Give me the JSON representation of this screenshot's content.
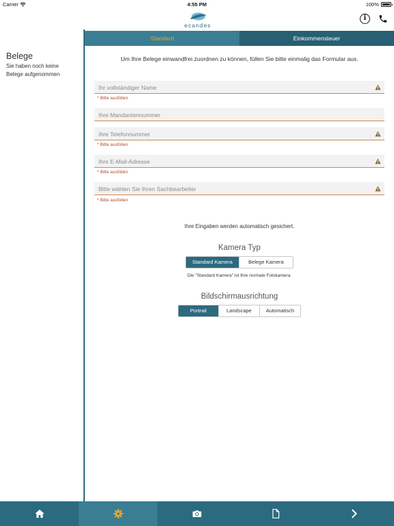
{
  "status_bar": {
    "carrier": "Carrier",
    "time": "4:55 PM",
    "battery": "100%"
  },
  "header": {
    "logo_text": "ecandes",
    "info_icon": "info-icon",
    "phone_icon": "phone-icon"
  },
  "sidebar": {
    "title": "Belege",
    "subtitle": "Sie haben noch keine Belege aufgenommen"
  },
  "tabs": [
    {
      "label": "Standard",
      "active": true
    },
    {
      "label": "Einkommensteuer",
      "active": false
    }
  ],
  "form": {
    "intro": "Um Ihre Belege einwandfrei zuordnen zu können, füllen Sie bitte einmalig das Formular aus.",
    "fields": [
      {
        "placeholder": "Ihr vollständiger Name",
        "value": "",
        "warning": true,
        "hint": "* Bitte ausfüllen"
      },
      {
        "placeholder": "Ihre Mandantennummer",
        "value": "",
        "warning": false,
        "hint": ""
      },
      {
        "placeholder": "Ihre Telefonnummer",
        "value": "",
        "warning": true,
        "hint": "* Bitte ausfüllen"
      },
      {
        "placeholder": "Ihre E-Mail-Adresse",
        "value": "",
        "warning": true,
        "hint": "* Bitte ausfüllen"
      },
      {
        "placeholder": "Bitte wählen Sie Ihren Sachbearbeiter",
        "value": "",
        "warning": true,
        "hint": "* Bitte ausfüllen"
      }
    ],
    "autosave_note": "Ihre Eingaben werden automatisch gesichert."
  },
  "camera": {
    "title": "Kamera Typ",
    "options": [
      "Standard Kamera",
      "Belege Kamera"
    ],
    "selected": "Standard Kamera",
    "note": "Die \"Standard Kamera\" ist Ihre normale Fotokamera."
  },
  "orientation": {
    "title": "Bildschirmausrichtung",
    "options": [
      "Portrait",
      "Landscape",
      "Automatisch"
    ],
    "selected": "Portrait"
  },
  "bottom_nav": [
    {
      "icon": "home-icon",
      "active": false
    },
    {
      "icon": "gear-icon",
      "active": true
    },
    {
      "icon": "camera-icon",
      "active": false
    },
    {
      "icon": "document-icon",
      "active": false
    },
    {
      "icon": "chevron-right-icon",
      "active": false
    }
  ],
  "colors": {
    "primary": "#2c6a80",
    "tab_active": "#3b7d92",
    "tab_active_text": "#e0a83a",
    "warning": "#8a6a3a",
    "hint": "#b24a2a"
  }
}
